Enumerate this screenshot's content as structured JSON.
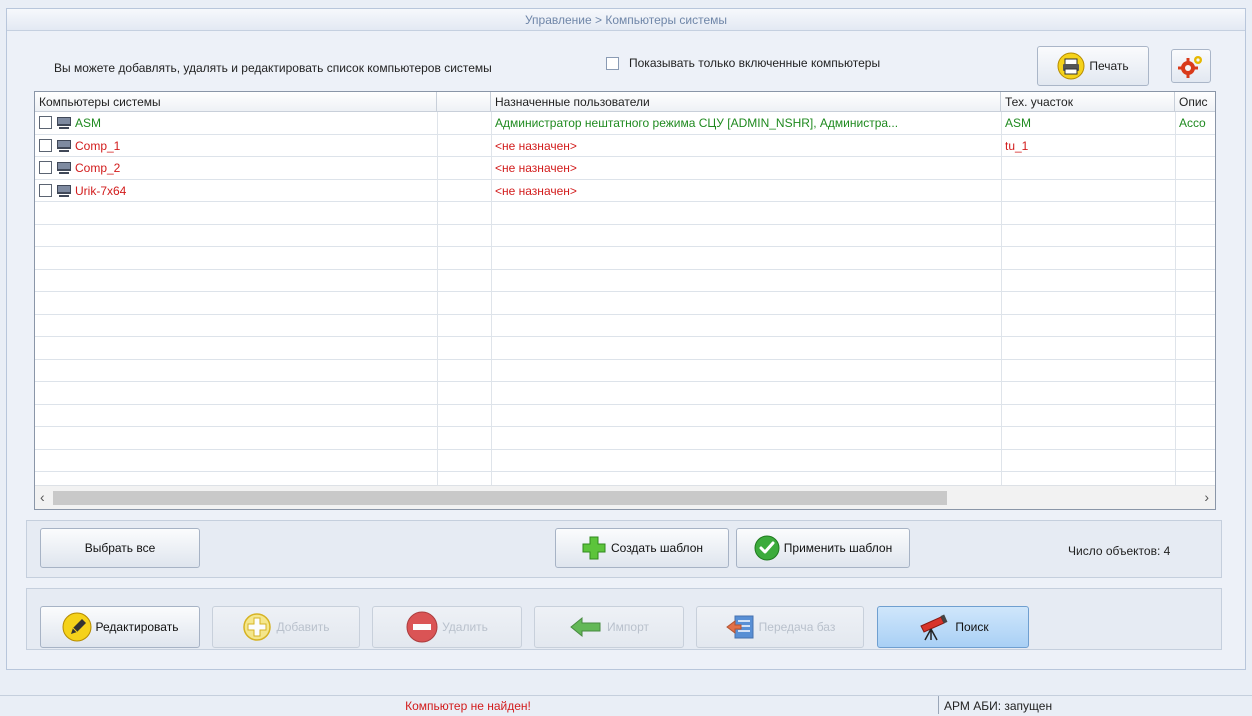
{
  "title": "Управление > Компьютеры системы",
  "info_text": "Вы можете добавлять, удалять и редактировать список компьютеров системы",
  "only_enabled_label": "Показывать только включенные компьютеры",
  "print_label": "Печать",
  "columns": [
    "Компьютеры системы",
    "Назначенные пользователи",
    "Тех. участок",
    "Опис"
  ],
  "rows": [
    {
      "name": "ASM",
      "users": "Администратор нештатного режима СЦУ [ADMIN_NSHR], Администра...",
      "section": "ASM",
      "description": "Acco",
      "status": "green"
    },
    {
      "name": "Comp_1",
      "users": "<не назначен>",
      "section": "tu_1",
      "description": "",
      "status": "red"
    },
    {
      "name": "Comp_2",
      "users": "<не назначен>",
      "section": "",
      "description": "",
      "status": "red"
    },
    {
      "name": "Urik-7x64",
      "users": "<не назначен>",
      "section": "",
      "description": "",
      "status": "red"
    }
  ],
  "buttons": {
    "select_all": "Выбрать все",
    "create_template": "Создать шаблон",
    "apply_template": "Применить шаблон",
    "edit": "Редактировать",
    "add": "Добавить",
    "delete": "Удалить",
    "import": "Импорт",
    "transfer": "Передача баз",
    "search": "Поиск"
  },
  "object_count": "Число объектов: 4",
  "status": {
    "message": "Компьютер не найден!",
    "arm": "АРМ АБИ: запущен"
  },
  "icons": [
    "printer-icon",
    "gears-icon",
    "computer-icon",
    "plus-icon",
    "check-icon",
    "pencil-icon",
    "delete-icon",
    "arrow-left-icon",
    "transfer-icon",
    "telescope-icon"
  ],
  "colors": {
    "ok": "#1f8a1f",
    "error": "#d21b1b",
    "title": "#6f86a8"
  }
}
